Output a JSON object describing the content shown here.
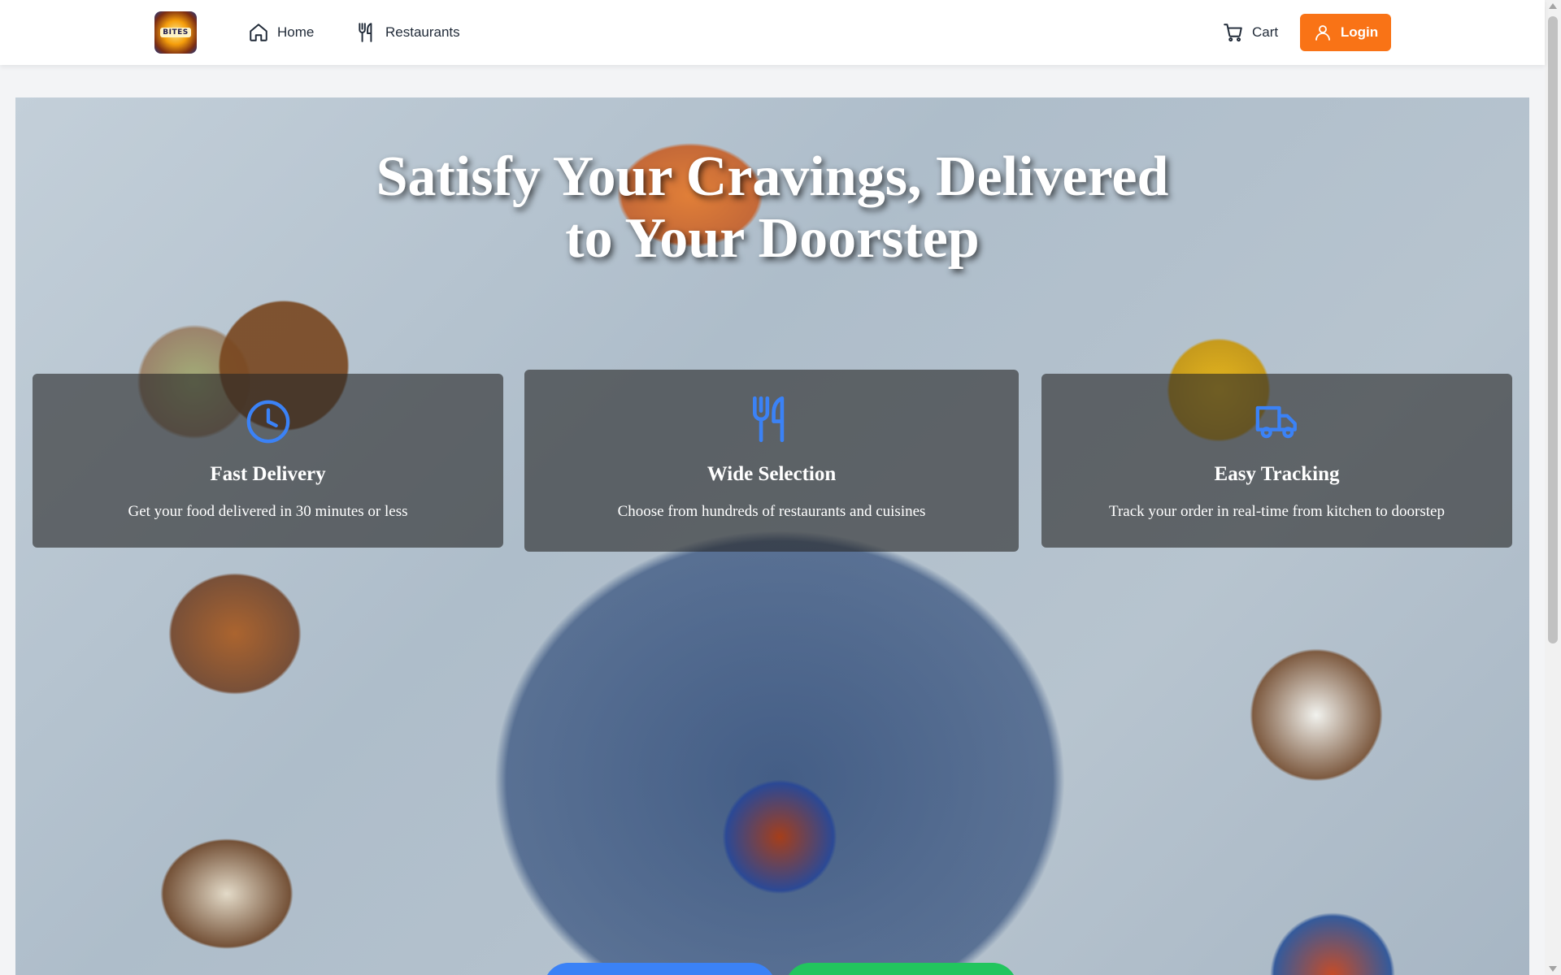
{
  "navbar": {
    "logo_text": "BITES",
    "links": [
      {
        "label": "Home",
        "icon": "home-icon"
      },
      {
        "label": "Restaurants",
        "icon": "utensils-icon"
      }
    ],
    "cart_label": "Cart",
    "login_label": "Login",
    "accent_color": "#f97316"
  },
  "hero": {
    "title_line1": "Satisfy Your Cravings, Delivered",
    "title_line2": "to Your Doorstep",
    "features": [
      {
        "title": "Fast Delivery",
        "description": "Get your food delivered in 30 minutes or less",
        "icon": "clock-icon"
      },
      {
        "title": "Wide Selection",
        "description": "Choose from hundreds of restaurants and cuisines",
        "icon": "utensils-icon"
      },
      {
        "title": "Easy Tracking",
        "description": "Track your order in real-time from kitchen to doorstep",
        "icon": "truck-icon"
      }
    ],
    "icon_color": "#3b82f6",
    "cta_colors": [
      "#3b82f6",
      "#22c55e"
    ]
  }
}
